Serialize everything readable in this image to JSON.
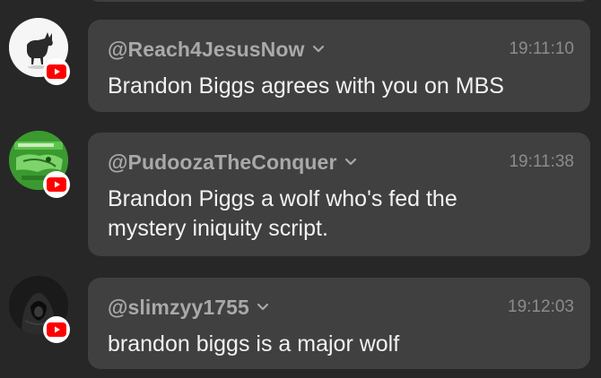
{
  "messages": [
    {
      "username": "@Reach4JesusNow",
      "time": "19:11:10",
      "text": "Brandon Biggs agrees with you on MBS",
      "avatar_icon": "goat-silhouette-avatar",
      "source_icon": "youtube-icon"
    },
    {
      "username": "@PudoozaTheConquer",
      "time": "19:11:38",
      "text": "Brandon Piggs a wolf who's fed the\nmystery iniquity script.",
      "avatar_icon": "green-meme-avatar",
      "source_icon": "youtube-icon"
    },
    {
      "username": "@slimzyy1755",
      "time": "19:12:03",
      "text": "brandon biggs is a major wolf",
      "avatar_icon": "hooded-figure-avatar",
      "source_icon": "youtube-icon"
    }
  ],
  "colors": {
    "background": "#272727",
    "bubble": "#404040",
    "username": "#a9a9a9",
    "time": "#8c8c8c",
    "text": "#f2f2f2",
    "youtube_red": "#ff0000"
  }
}
